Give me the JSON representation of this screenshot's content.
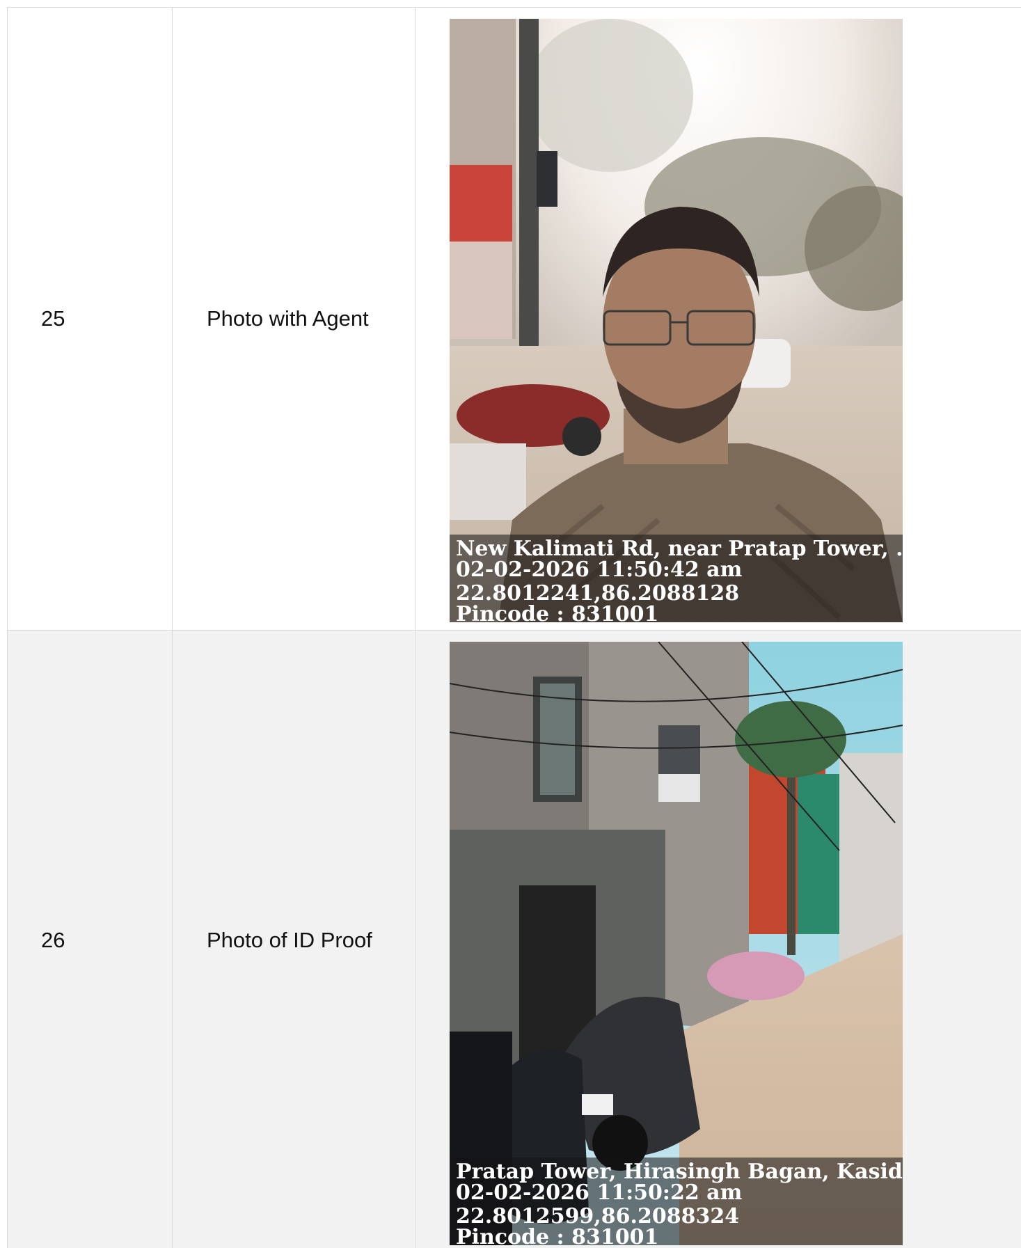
{
  "rows": [
    {
      "number": "25",
      "label": "Photo with Agent",
      "photo": {
        "description_icon": "selfie-photo",
        "caption": {
          "address": "New Kalimati Rd, near Pratap Tower, ...",
          "datetime": "02-02-2026 11:50:42 am",
          "coordinates": "22.8012241,86.2088128",
          "pincode": "Pincode : 831001"
        }
      }
    },
    {
      "number": "26",
      "label": "Photo of ID Proof",
      "photo": {
        "description_icon": "street-photo",
        "caption": {
          "address": "Pratap Tower, Hirasingh Bagan, Kasidih, Ja",
          "datetime": "02-02-2026 11:50:22 am",
          "coordinates": "22.8012599,86.2088324",
          "pincode": "Pincode : 831001"
        }
      }
    }
  ],
  "colors": {
    "border": "#d9d9d9",
    "alt_row": "#f2f2f2",
    "caption_bg": "rgba(20,20,20,0.55)"
  }
}
